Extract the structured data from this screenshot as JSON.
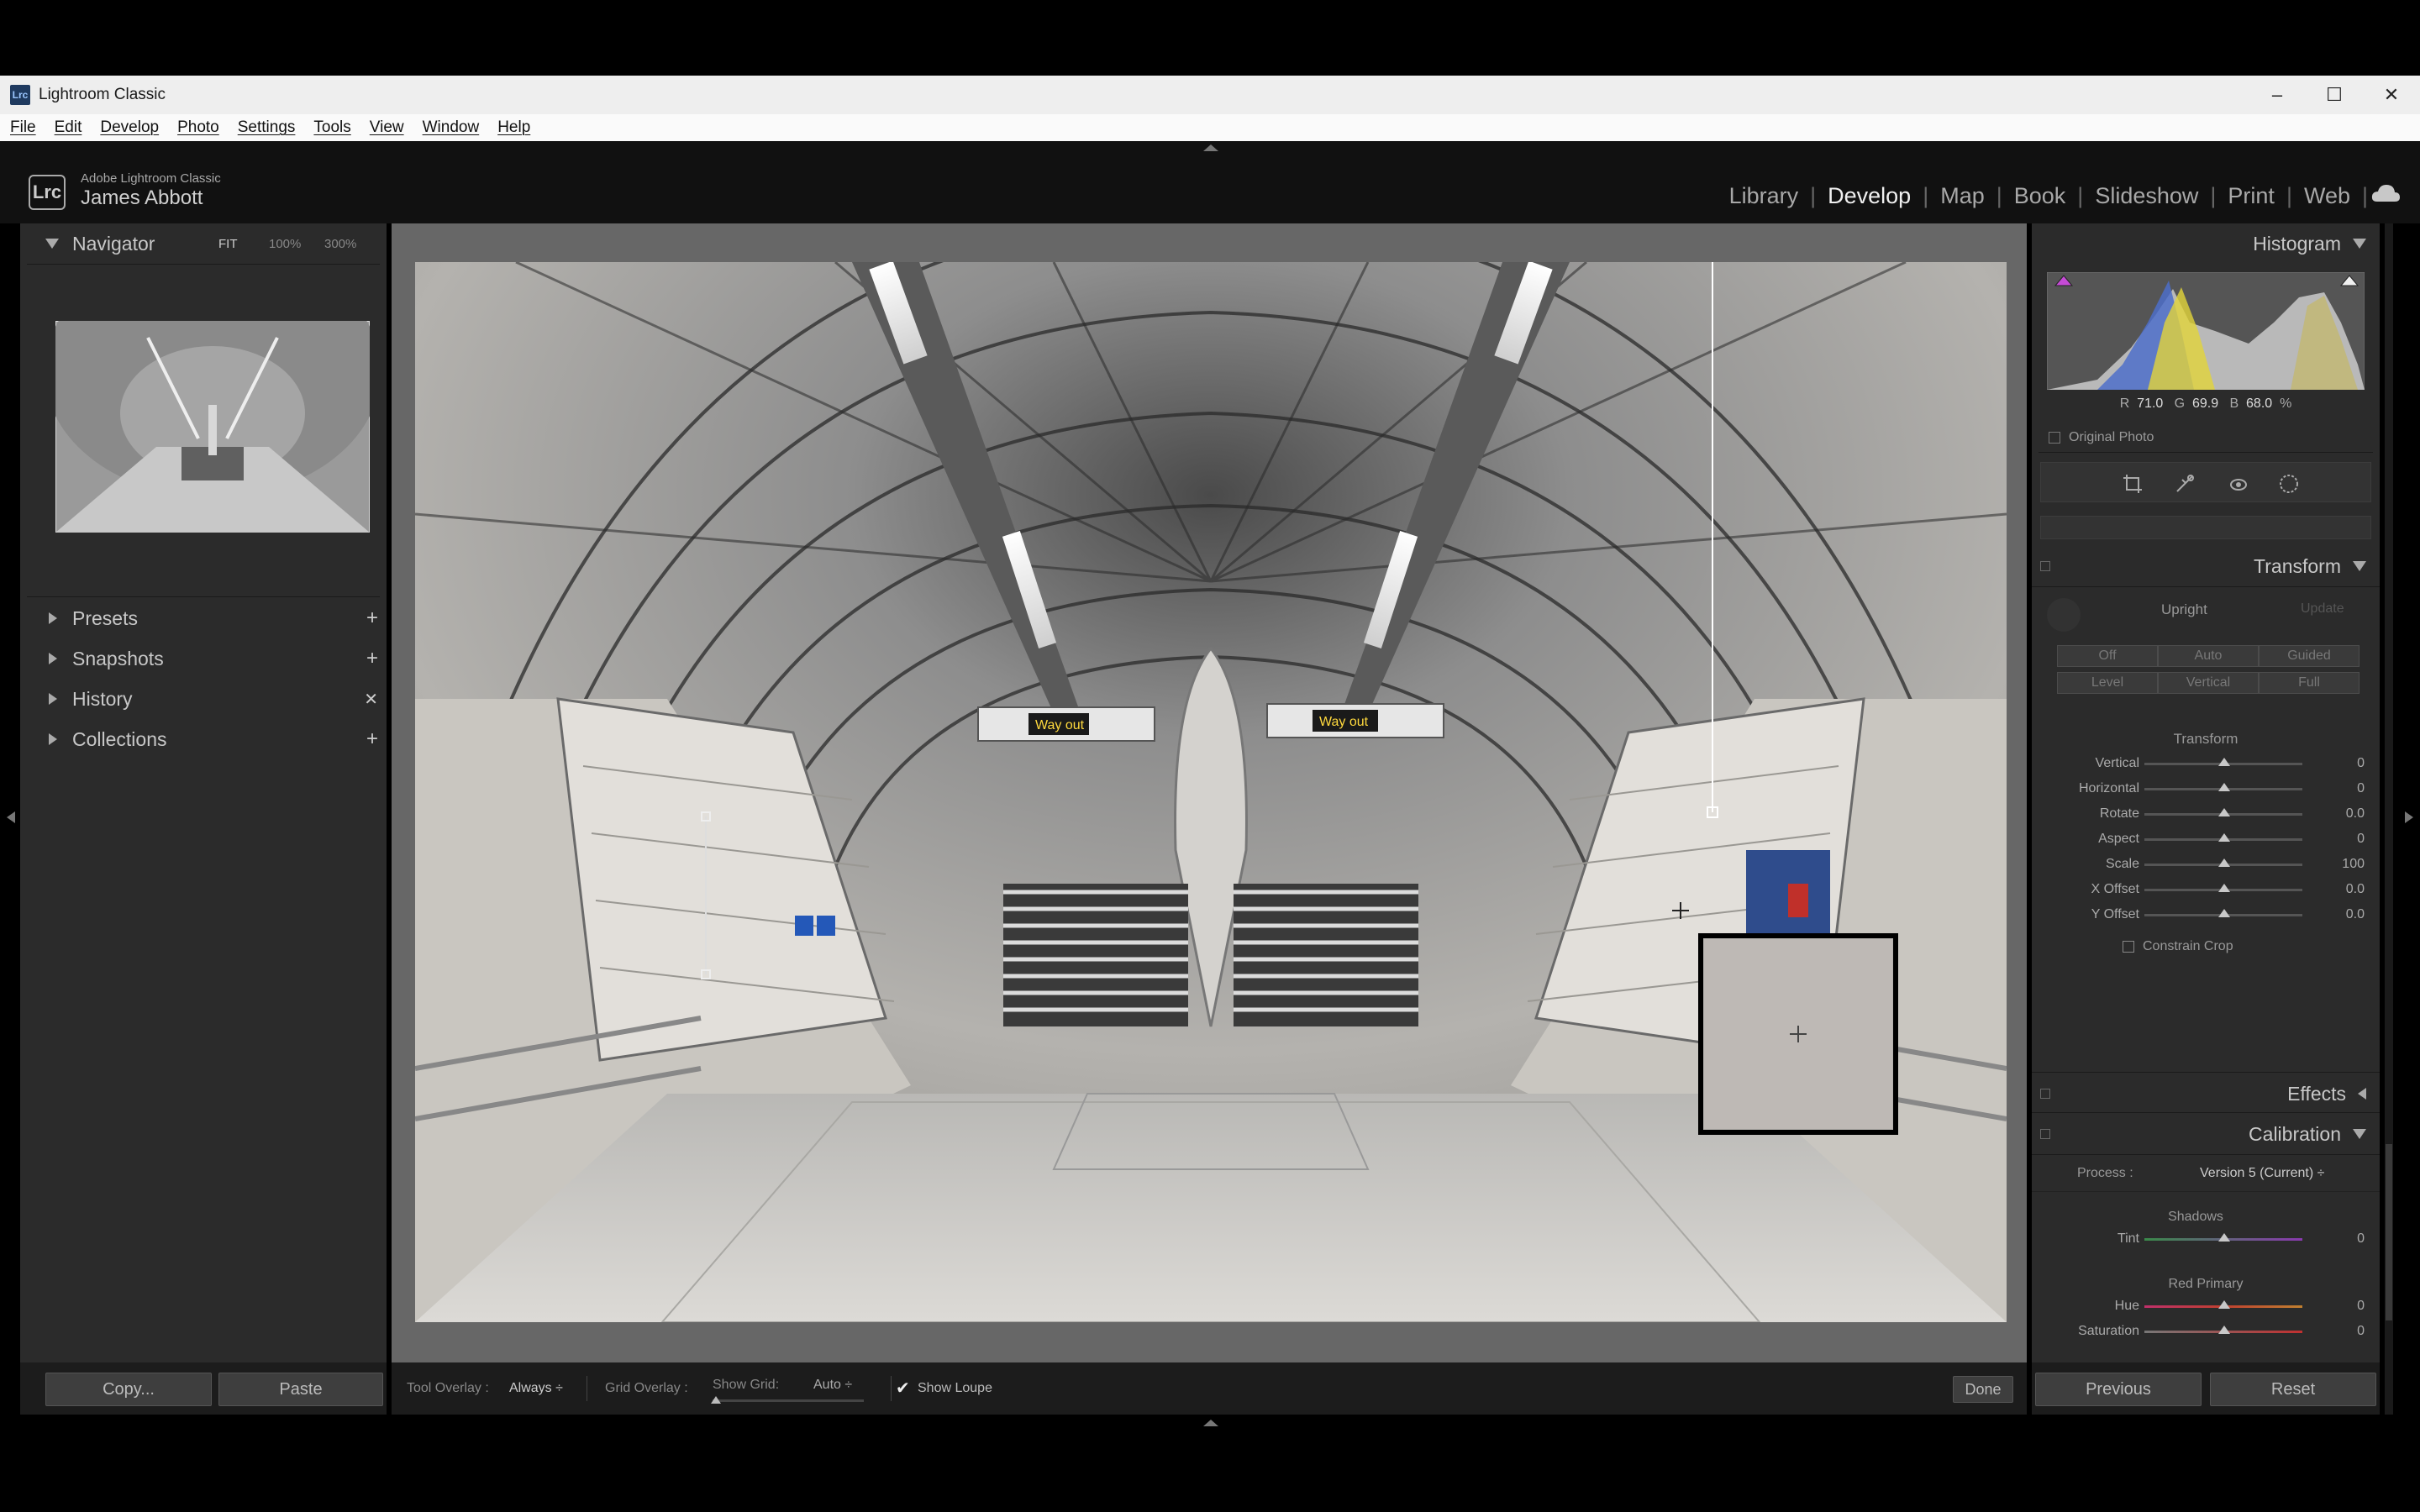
{
  "window": {
    "title": "Lightroom Classic",
    "logo_text": "Lrc",
    "controls": [
      "–",
      "☐",
      "✕"
    ]
  },
  "menu": [
    "File",
    "Edit",
    "Develop",
    "Photo",
    "Settings",
    "Tools",
    "View",
    "Window",
    "Help"
  ],
  "identity": {
    "badge": "Lrc",
    "product": "Adobe Lightroom Classic",
    "user": "James Abbott"
  },
  "modules": {
    "items": [
      "Library",
      "Develop",
      "Map",
      "Book",
      "Slideshow",
      "Print",
      "Web"
    ],
    "active": "Develop"
  },
  "navigator": {
    "title": "Navigator",
    "zoom_options": [
      "FIT",
      "100%",
      "300%"
    ]
  },
  "left_sections": [
    {
      "label": "Presets",
      "action": "+"
    },
    {
      "label": "Snapshots",
      "action": "+"
    },
    {
      "label": "History",
      "action": "✕"
    },
    {
      "label": "Collections",
      "action": "+"
    }
  ],
  "left_buttons": {
    "copy": "Copy...",
    "paste": "Paste"
  },
  "histogram": {
    "title": "Histogram",
    "rgb": {
      "r_label": "R",
      "r": "71.0",
      "g_label": "G",
      "g": "69.9",
      "b_label": "B",
      "b": "68.0",
      "unit": "%"
    },
    "original_photo": "Original Photo"
  },
  "transform": {
    "title": "Transform",
    "upright_label": "Upright",
    "update_label": "Update",
    "upright_buttons": [
      "Off",
      "Auto",
      "Guided",
      "Level",
      "Vertical",
      "Full"
    ],
    "section_label": "Transform",
    "sliders": [
      {
        "label": "Vertical",
        "value": "0"
      },
      {
        "label": "Horizontal",
        "value": "0"
      },
      {
        "label": "Rotate",
        "value": "0.0"
      },
      {
        "label": "Aspect",
        "value": "0"
      },
      {
        "label": "Scale",
        "value": "100"
      },
      {
        "label": "X Offset",
        "value": "0.0"
      },
      {
        "label": "Y Offset",
        "value": "0.0"
      }
    ],
    "constrain_crop": "Constrain Crop"
  },
  "effects": {
    "title": "Effects"
  },
  "calibration": {
    "title": "Calibration",
    "process_label": "Process :",
    "process_value": "Version 5 (Current) ÷",
    "shadows_label": "Shadows",
    "tint": {
      "label": "Tint",
      "value": "0"
    },
    "red_primary_label": "Red Primary",
    "hue": {
      "label": "Hue",
      "value": "0"
    },
    "saturation": {
      "label": "Saturation",
      "value": "0"
    }
  },
  "right_buttons": {
    "previous": "Previous",
    "reset": "Reset"
  },
  "toolbar": {
    "tool_overlay_label": "Tool Overlay :",
    "tool_overlay_value": "Always ÷",
    "grid_overlay_label": "Grid Overlay :",
    "show_grid_label": "Show Grid:",
    "show_grid_value": "Auto ÷",
    "show_loupe_label": "Show Loupe",
    "show_loupe_checked": true,
    "done_label": "Done"
  },
  "photo_signs": {
    "way_out_left": "Way out",
    "way_out_right": "Way out"
  },
  "colors": {
    "panel_bg": "#2b2b2b",
    "center_bg": "#676767",
    "app_bg": "#111111"
  }
}
